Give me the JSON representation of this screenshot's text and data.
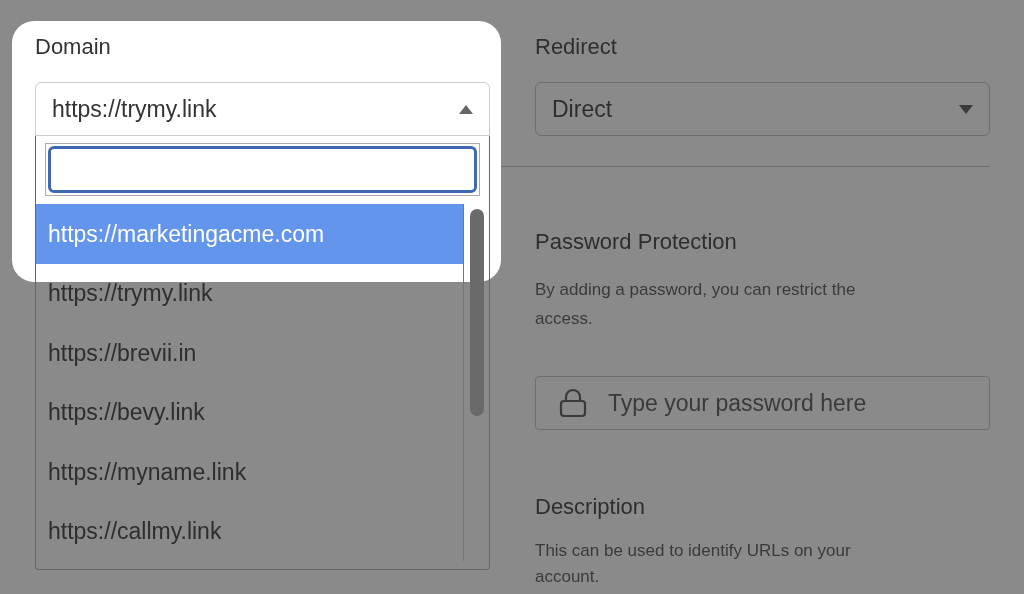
{
  "domain": {
    "label": "Domain",
    "value": "https://trymy.link",
    "expanded": true,
    "options": [
      {
        "label": "https://marketingacme.com",
        "highlighted": true
      },
      {
        "label": "https://trymy.link",
        "highlighted": false
      },
      {
        "label": "https://brevii.in",
        "highlighted": false
      },
      {
        "label": "https://bevy.link",
        "highlighted": false
      },
      {
        "label": "https://myname.link",
        "highlighted": false
      },
      {
        "label": "https://callmy.link",
        "highlighted": false
      }
    ]
  },
  "redirect": {
    "label": "Redirect",
    "value": "Direct",
    "expanded": false
  },
  "password": {
    "title": "Password Protection",
    "description": "By adding a password, you can restrict the access.",
    "placeholder": "Type your password here"
  },
  "description": {
    "title": "Description",
    "text": "This can be used to identify URLs on your account."
  }
}
